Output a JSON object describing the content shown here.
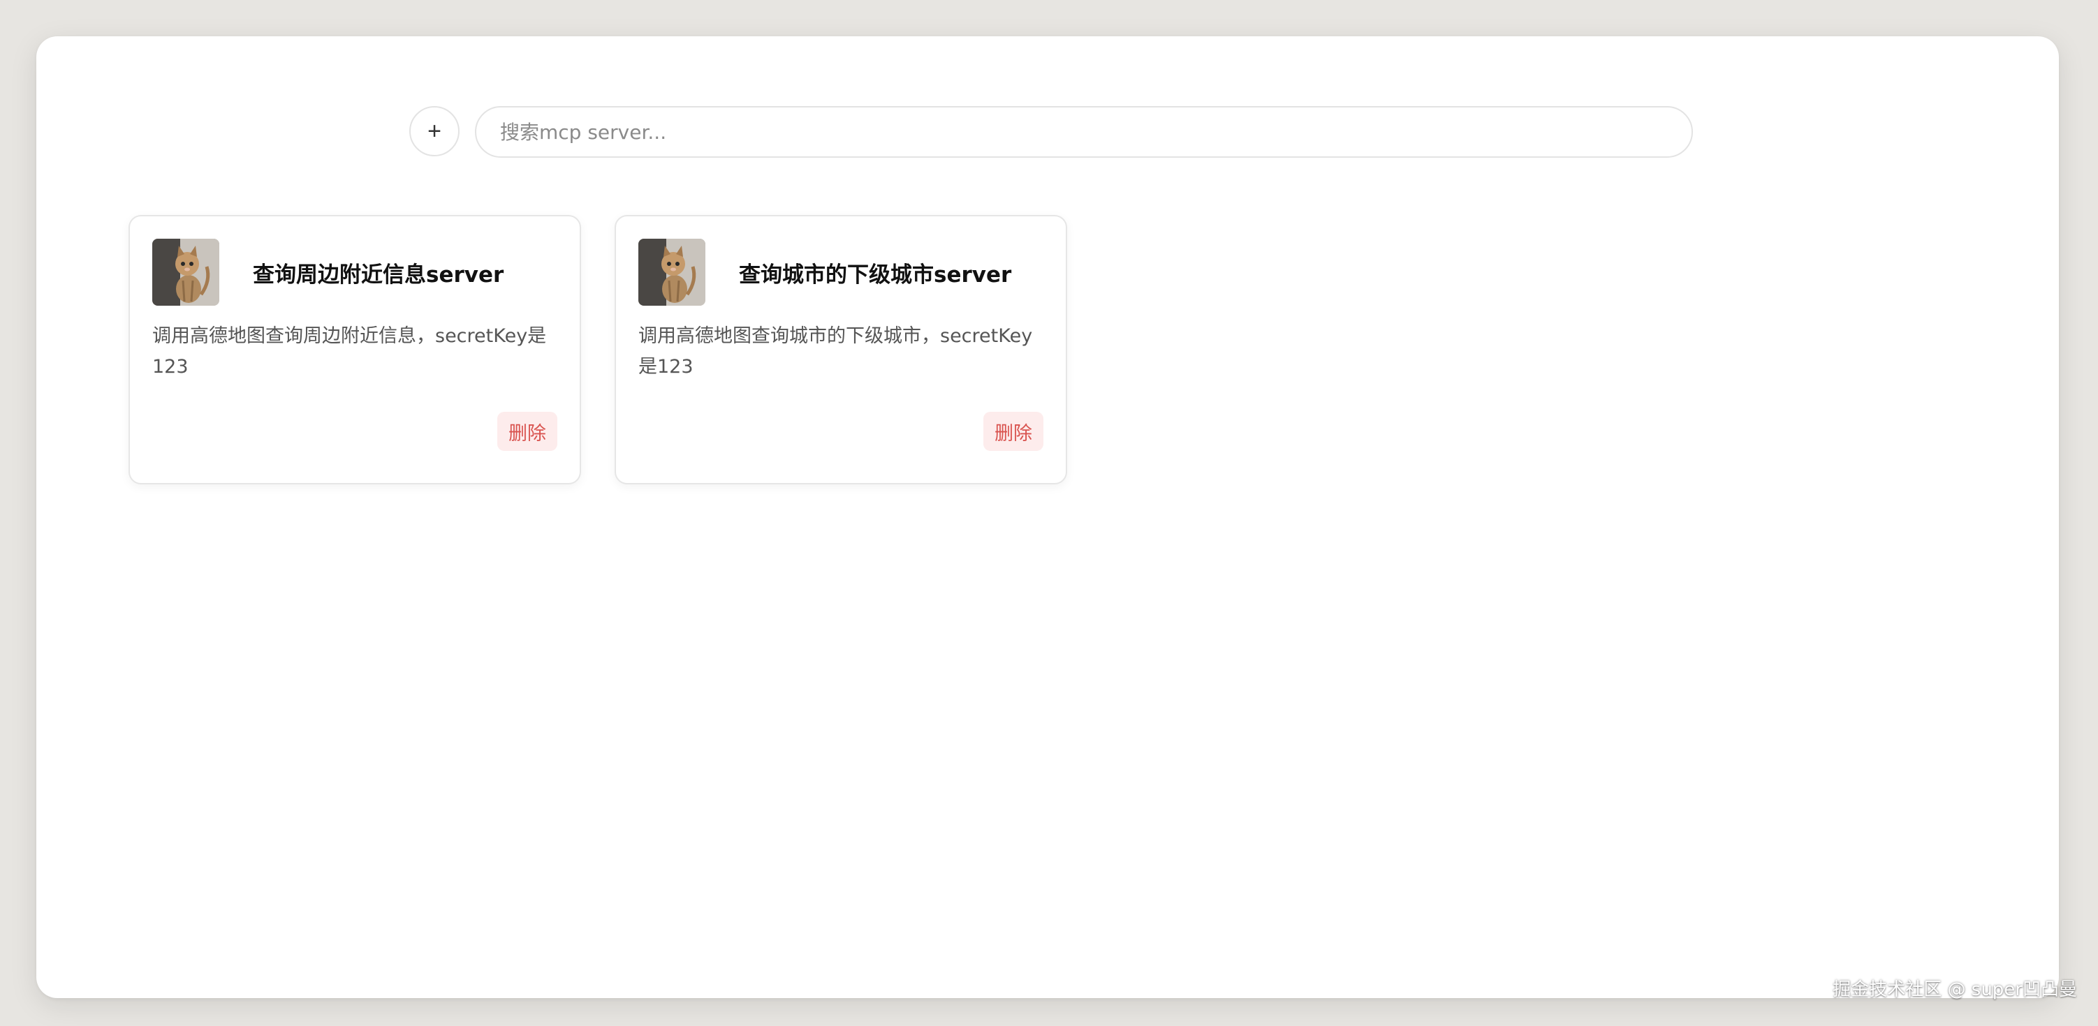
{
  "toolbar": {
    "add_label": "+",
    "search_placeholder": "搜索mcp server...",
    "search_value": ""
  },
  "servers": [
    {
      "title": "查询周边附近信息server",
      "description": "调用高德地图查询周边附近信息，secretKey是123",
      "delete_label": "删除",
      "avatar_icon": "kitten-photo"
    },
    {
      "title": "查询城市的下级城市server",
      "description": "调用高德地图查询城市的下级城市，secretKey是123",
      "delete_label": "删除",
      "avatar_icon": "kitten-photo"
    }
  ],
  "watermark": "掘金技术社区 @ super凹凸曼",
  "colors": {
    "background": "#e7e5e1",
    "panel": "#ffffff",
    "delete_bg": "#fdecec",
    "delete_text": "#d9534f"
  }
}
